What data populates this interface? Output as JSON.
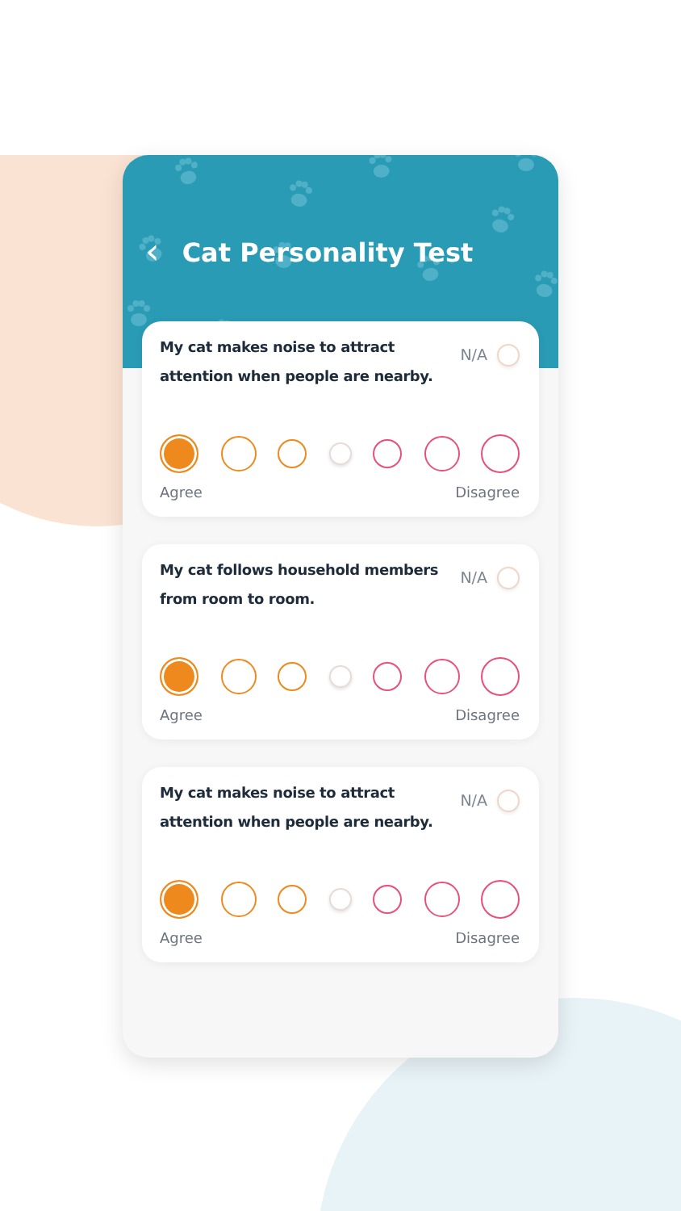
{
  "header": {
    "back_icon": "‹",
    "title": "Cat Personality Test"
  },
  "questions": [
    {
      "text": "My cat makes noise to attract attention when people are nearby.",
      "na_label": "N/A",
      "na_selected": false,
      "agree_label": "Agree",
      "disagree_label": "Disagree",
      "options": [
        {
          "selected": true,
          "color": "#ee8a1d"
        },
        {
          "selected": false,
          "color": "#ee8a1d"
        },
        {
          "selected": false,
          "color": "#ee8a1d"
        },
        {
          "selected": false,
          "color": "#e6dcd8"
        },
        {
          "selected": false,
          "color": "#e8507a"
        },
        {
          "selected": false,
          "color": "#e8507a"
        },
        {
          "selected": false,
          "color": "#e8507a"
        }
      ]
    },
    {
      "text": "My cat follows household members from room to room.",
      "na_label": "N/A",
      "na_selected": false,
      "agree_label": "Agree",
      "disagree_label": "Disagree",
      "options": [
        {
          "selected": true,
          "color": "#ee8a1d"
        },
        {
          "selected": false,
          "color": "#ee8a1d"
        },
        {
          "selected": false,
          "color": "#ee8a1d"
        },
        {
          "selected": false,
          "color": "#e6dcd8"
        },
        {
          "selected": false,
          "color": "#e8507a"
        },
        {
          "selected": false,
          "color": "#e8507a"
        },
        {
          "selected": false,
          "color": "#e8507a"
        }
      ]
    },
    {
      "text": "My cat makes noise to attract attention when people are nearby.",
      "na_label": "N/A",
      "na_selected": false,
      "agree_label": "Agree",
      "disagree_label": "Disagree",
      "options": [
        {
          "selected": true,
          "color": "#ee8a1d"
        },
        {
          "selected": false,
          "color": "#ee8a1d"
        },
        {
          "selected": false,
          "color": "#ee8a1d"
        },
        {
          "selected": false,
          "color": "#e6dcd8"
        },
        {
          "selected": false,
          "color": "#e8507a"
        },
        {
          "selected": false,
          "color": "#e8507a"
        },
        {
          "selected": false,
          "color": "#e8507a"
        }
      ]
    }
  ]
}
